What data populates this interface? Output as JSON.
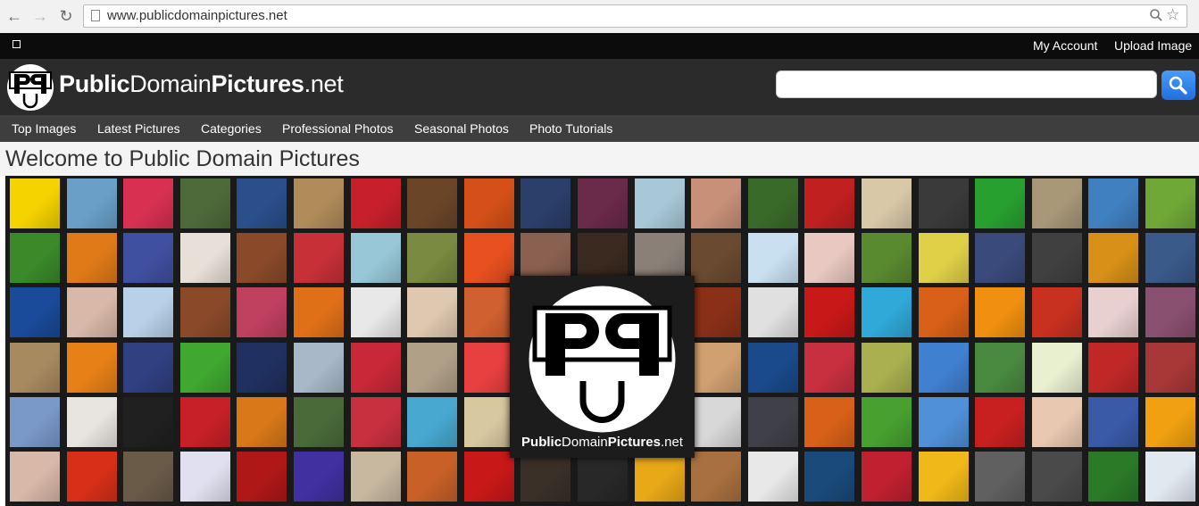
{
  "browser": {
    "url": "www.publicdomainpictures.net"
  },
  "topbar": {
    "my_account": "My Account",
    "upload_image": "Upload Image"
  },
  "header": {
    "logo_part1": "Public",
    "logo_part2": "Domain",
    "logo_part3": "Pictures",
    "logo_part4": ".net",
    "search_placeholder": ""
  },
  "menu": {
    "items": [
      "Top Images",
      "Latest Pictures",
      "Categories",
      "Professional Photos",
      "Seasonal Photos",
      "Photo Tutorials"
    ]
  },
  "main": {
    "welcome_title": "Welcome to Public Domain Pictures"
  },
  "center_logo": {
    "bold_public": "Public",
    "normal_domain": "Domain",
    "bold_pictures": "Pictures",
    "normal_net": ".net"
  },
  "thumbnails": {
    "colors": [
      [
        "#f5d300",
        "#6aa0c8",
        "#d83050",
        "#4e6a3a",
        "#2a4f8a",
        "#b08c5a",
        "#c8202a",
        "#6b4528",
        "#d45018",
        "#2b3f6a",
        "#6a2a4a",
        "#a8c8d8",
        "#c89078",
        "#3a6a2a",
        "#c02020",
        "#d8c8a8",
        "#3a3a3a",
        "#28a030",
        "#a89878",
        "#4080c0",
        "#70a838"
      ],
      [
        "#3a8a2a",
        "#e07a18",
        "#4050a0",
        "#e8e0d8",
        "#8a4a2a",
        "#c83038",
        "#98c8d8",
        "#7a8a40",
        "#e85020",
        "#8a6050",
        "#3a2a20",
        "#8a8078",
        "#6a4a30",
        "#c8e0f0",
        "#e8c8c0",
        "#5a8a30",
        "#e0d048",
        "#3a4a7a",
        "#404040",
        "#d89018",
        "#3a5a8a"
      ],
      [
        "#1a4a9a",
        "#d8b8a8",
        "#b8d0e8",
        "#8a4a2a",
        "#c04060",
        "#e07018",
        "#e8e8e8",
        "#e0c8b0",
        "#d06030",
        "#",
        "#",
        "#",
        "#8a3018",
        "#e0e0e0",
        "#c81818",
        "#30a8d8",
        "#d86018",
        "#f09010",
        "#c83020",
        "#e8d0d0",
        "#8a5070"
      ],
      [
        "#a88a60",
        "#e88018",
        "#304080",
        "#40a830",
        "#203060",
        "#a8b8c8",
        "#c82838",
        "#b0a088",
        "#e84040",
        "#",
        "#",
        "#",
        "#d0a070",
        "#1a4a8a",
        "#c83040",
        "#a8b050",
        "#4080d0",
        "#4a8a40",
        "#e8f0d0",
        "#c02828",
        "#a83838"
      ],
      [
        "#7a98c8",
        "#e8e4e0",
        "#202020",
        "#c82028",
        "#d87818",
        "#4a6a3a",
        "#c83040",
        "#48a8d0",
        "#d8c8a0",
        "#",
        "#",
        "#",
        "#d8d8d8",
        "#404048",
        "#d86018",
        "#48a030",
        "#5090d8",
        "#c82020",
        "#e8c8b0",
        "#3a5aa8",
        "#f0a010"
      ],
      [
        "#d8b8a8",
        "#d83018",
        "#6a5a48",
        "#e0e0f0",
        "#b01818",
        "#4030a0",
        "#c8b8a0",
        "#c86028",
        "#c81818",
        "#3a3028",
        "#282828",
        "#e8a818",
        "#a87040",
        "#e8e8e8",
        "#1a4a7a",
        "#c02030",
        "#f0b818",
        "#606060",
        "#4a4a4a",
        "#2a7a28",
        "#e0e8f0"
      ]
    ]
  }
}
